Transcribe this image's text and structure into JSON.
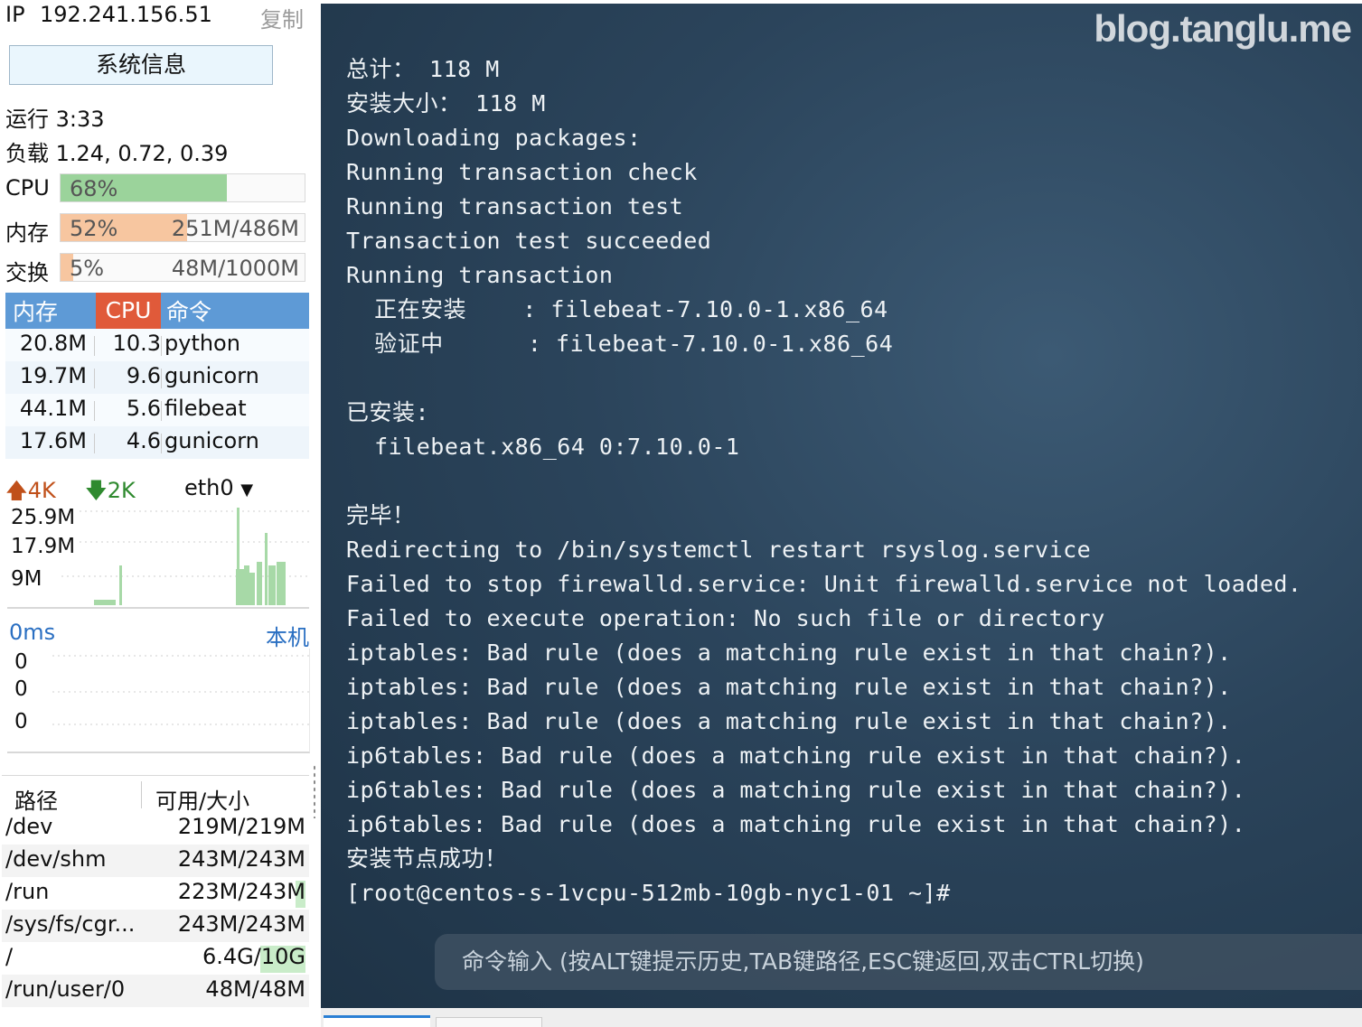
{
  "sidebar": {
    "ip_label": "IP",
    "ip_value": "192.241.156.51",
    "copy_label": "复制",
    "sysinfo_button": "系统信息",
    "uptime": "运行 3:33",
    "load": "负载 1.24, 0.72, 0.39",
    "meters": {
      "cpu": {
        "label": "CPU",
        "percent_text": "68%",
        "amount": "",
        "fill": 0.68,
        "color": "#9bd39b"
      },
      "mem": {
        "label": "内存",
        "percent_text": "52%",
        "amount": "251M/486M",
        "fill": 0.52,
        "color": "#f7c6a0"
      },
      "swap": {
        "label": "交换",
        "percent_text": "5%",
        "amount": "48M/1000M",
        "fill": 0.05,
        "color": "#f7c6a0"
      }
    },
    "process_table": {
      "headers": {
        "mem": "内存",
        "cpu": "CPU",
        "cmd": "命令"
      },
      "rows": [
        {
          "mem": "20.8M",
          "cpu": "10.3",
          "cmd": "python"
        },
        {
          "mem": "19.7M",
          "cpu": "9.6",
          "cmd": "gunicorn"
        },
        {
          "mem": "44.1M",
          "cpu": "5.6",
          "cmd": "filebeat"
        },
        {
          "mem": "17.6M",
          "cpu": "4.6",
          "cmd": "gunicorn"
        }
      ]
    },
    "network": {
      "up": "4K",
      "down": "2K",
      "interface": "eth0",
      "scale_labels": [
        "25.9M",
        "17.9M",
        "9M"
      ]
    },
    "latency": {
      "ms": "0ms",
      "host": "本机",
      "scale_labels": [
        "0",
        "0",
        "0"
      ]
    },
    "disk_table": {
      "headers": {
        "path": "路径",
        "size": "可用/大小"
      },
      "rows": [
        {
          "path": "/dev",
          "size": "219M/219M",
          "used": 0.0
        },
        {
          "path": "/dev/shm",
          "size": "243M/243M",
          "used": 0.0
        },
        {
          "path": "/run",
          "size": "223M/243M",
          "used": 0.08
        },
        {
          "path": "/sys/fs/cgr...",
          "size": "243M/243M",
          "used": 0.0
        },
        {
          "path": "/",
          "size": "6.4G/10G",
          "used": 0.36
        },
        {
          "path": "/run/user/0",
          "size": "48M/48M",
          "used": 0.0
        }
      ]
    }
  },
  "terminal": {
    "watermark": "blog.tanglu.me",
    "lines": [
      "总计： 118 M",
      "安装大小： 118 M",
      "Downloading packages:",
      "Running transaction check",
      "Running transaction test",
      "Transaction test succeeded",
      "Running transaction",
      "  正在安装    : filebeat-7.10.0-1.x86_64",
      "  验证中      : filebeat-7.10.0-1.x86_64",
      "",
      "已安装:",
      "  filebeat.x86_64 0:7.10.0-1",
      "",
      "完毕！",
      "Redirecting to /bin/systemctl restart rsyslog.service",
      "Failed to stop firewalld.service: Unit firewalld.service not loaded.",
      "Failed to execute operation: No such file or directory",
      "iptables: Bad rule (does a matching rule exist in that chain?).",
      "iptables: Bad rule (does a matching rule exist in that chain?).",
      "iptables: Bad rule (does a matching rule exist in that chain?).",
      "ip6tables: Bad rule (does a matching rule exist in that chain?).",
      "ip6tables: Bad rule (does a matching rule exist in that chain?).",
      "ip6tables: Bad rule (does a matching rule exist in that chain?).",
      "安装节点成功！",
      "[root@centos-s-1vcpu-512mb-10gb-nyc1-01 ~]#"
    ],
    "command_placeholder": "命令输入 (按ALT键提示历史,TAB键路径,ESC键返回,双击CTRL切换)"
  }
}
